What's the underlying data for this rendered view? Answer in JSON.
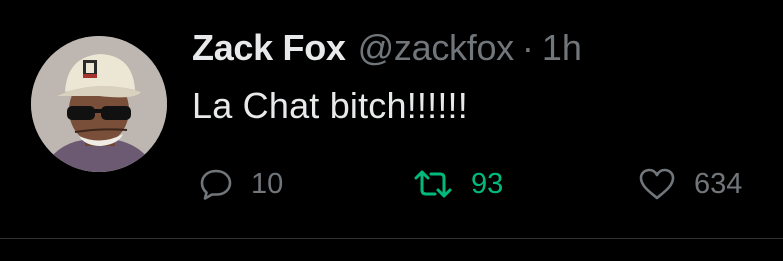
{
  "tweet": {
    "author": {
      "display_name": "Zack Fox",
      "handle": "@zackfox"
    },
    "separator": "·",
    "timestamp": "1h",
    "text": "La Chat bitch!!!!!!",
    "actions": {
      "reply": {
        "icon": "reply-icon",
        "count": "10"
      },
      "retweet": {
        "icon": "retweet-icon",
        "count": "93",
        "active": true,
        "color": "#00ba7c"
      },
      "like": {
        "icon": "heart-icon",
        "count": "634"
      }
    }
  },
  "colors": {
    "background": "#000000",
    "text_primary": "#e7e9ea",
    "text_secondary": "#71767b",
    "retweet_active": "#00ba7c"
  }
}
